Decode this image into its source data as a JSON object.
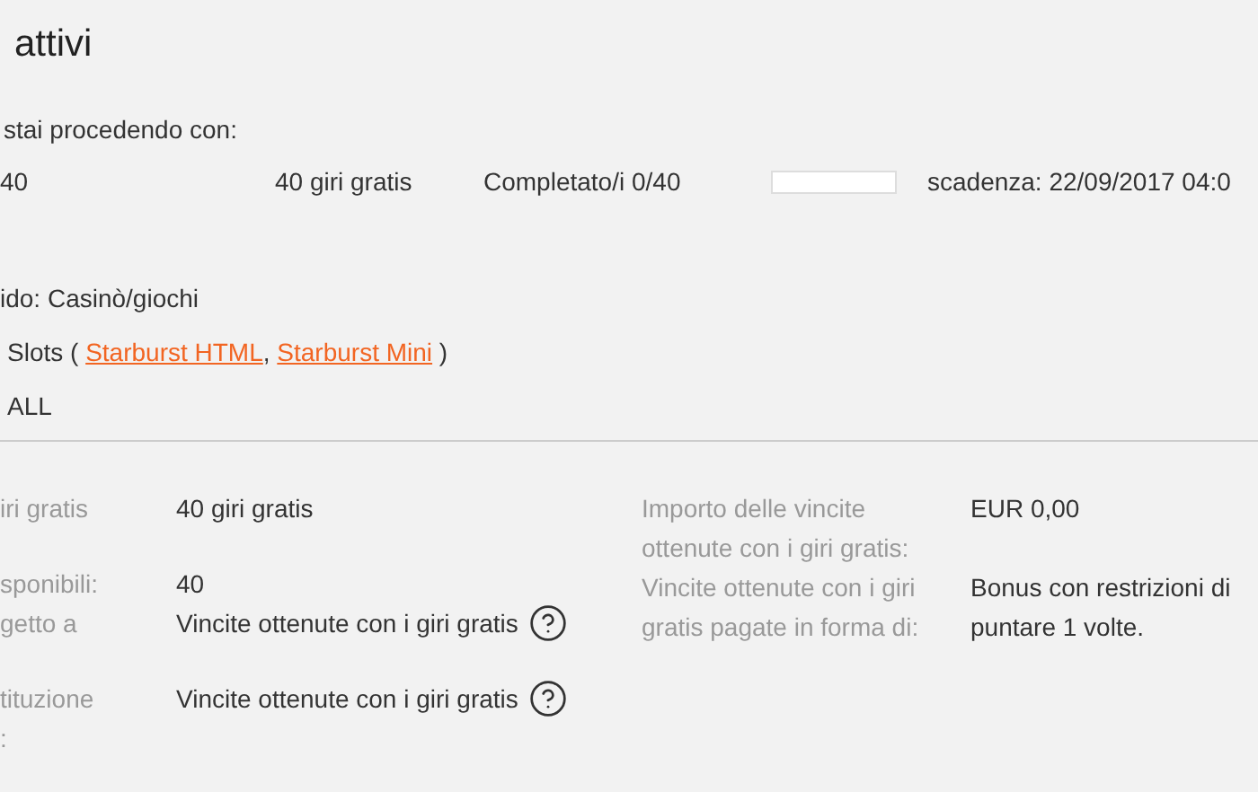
{
  "title": "attivi",
  "intro": "stai procedendo con:",
  "bonus_row": {
    "count": "40",
    "name": "40 giri gratis",
    "progress_text": "Completato/i 0/40",
    "level": 0,
    "expiry": "scadenza: 22/09/2017 04:0"
  },
  "info": [
    {
      "kind": "text",
      "text": "ido: Casinò/giochi"
    },
    {
      "kind": "links",
      "before": "Slots (",
      "links": [
        "Starburst HTML",
        "Starburst Mini"
      ],
      "separator": ",",
      "after": ")"
    },
    {
      "kind": "text",
      "text": "ALL"
    }
  ],
  "details_left": [
    [
      {
        "label": "iri gratis",
        "value": "40 giri gratis",
        "help": false
      }
    ],
    [
      {
        "label": "sponibili:",
        "value": "40",
        "help": false
      },
      {
        "label": "getto a",
        "value": "Vincite ottenute con i giri gratis",
        "help": true
      }
    ],
    [
      {
        "label": "tituzione\n:",
        "value": "Vincite ottenute con i giri gratis",
        "help": true
      }
    ]
  ],
  "details_right": [
    {
      "label": "Importo delle vincite ottenute con i giri gratis:",
      "value": "EUR 0,00"
    },
    {
      "label": "Vincite ottenute con i giri gratis pagate in forma di:",
      "value": "Bonus con restrizioni di puntare 1 volte."
    }
  ]
}
